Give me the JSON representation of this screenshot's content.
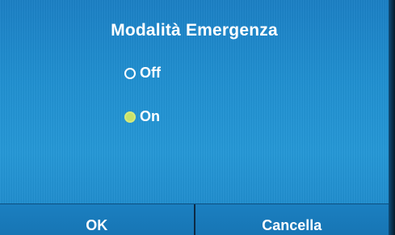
{
  "dialog": {
    "title": "Modalità Emergenza",
    "options": [
      {
        "label": "Off",
        "selected": false
      },
      {
        "label": "On",
        "selected": true
      }
    ],
    "buttons": {
      "ok_label": "OK",
      "cancel_label": "Cancella"
    }
  },
  "colors": {
    "background": "#1f8fd0",
    "text": "#ffffff",
    "selected_radio": "#c9e26a",
    "divider": "#0d2a44"
  }
}
